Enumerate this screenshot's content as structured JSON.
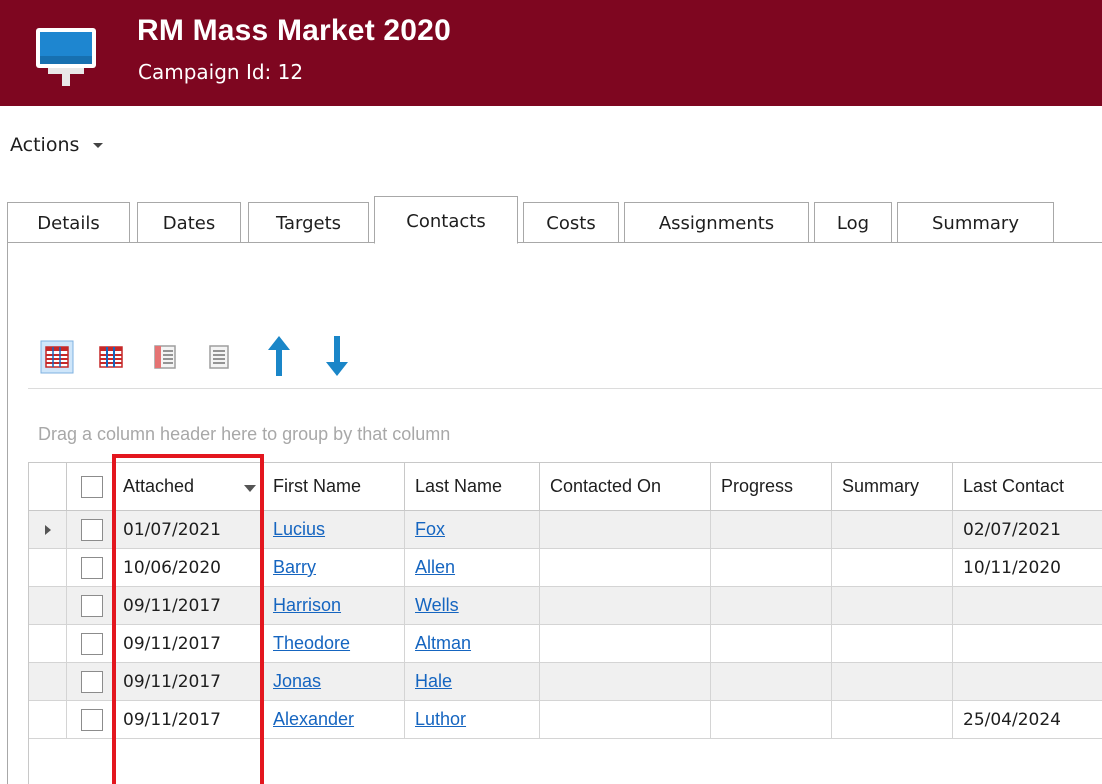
{
  "header": {
    "title": "RM Mass Market 2020",
    "subtitle": "Campaign Id: 12",
    "icon": "presentation-board-icon"
  },
  "actions": {
    "label": "Actions"
  },
  "tabs": [
    {
      "label": "Details"
    },
    {
      "label": "Dates"
    },
    {
      "label": "Targets"
    },
    {
      "label": "Contacts",
      "active": true
    },
    {
      "label": "Costs"
    },
    {
      "label": "Assignments"
    },
    {
      "label": "Log"
    },
    {
      "label": "Summary"
    }
  ],
  "toolbar": {
    "icons": [
      "grid-view-icon",
      "grid-columns-icon",
      "grid-detail-icon",
      "grid-list-icon",
      "move-up-icon",
      "move-down-icon"
    ]
  },
  "grid": {
    "group_hint": "Drag a column header here to group by that column",
    "columns": [
      "Attached",
      "First Name",
      "Last Name",
      "Contacted On",
      "Progress",
      "Summary",
      "Last Contact"
    ],
    "rows": [
      {
        "attached": "01/07/2021",
        "first": "Lucius",
        "last": "Fox",
        "contacted": "",
        "progress": "",
        "summary": "",
        "last_contact": "02/07/2021"
      },
      {
        "attached": "10/06/2020",
        "first": "Barry",
        "last": "Allen",
        "contacted": "",
        "progress": "",
        "summary": "",
        "last_contact": "10/11/2020"
      },
      {
        "attached": "09/11/2017",
        "first": "Harrison",
        "last": "Wells",
        "contacted": "",
        "progress": "",
        "summary": "",
        "last_contact": ""
      },
      {
        "attached": "09/11/2017",
        "first": "Theodore",
        "last": "Altman",
        "contacted": "",
        "progress": "",
        "summary": "",
        "last_contact": ""
      },
      {
        "attached": "09/11/2017",
        "first": "Jonas",
        "last": "Hale",
        "contacted": "",
        "progress": "",
        "summary": "",
        "last_contact": ""
      },
      {
        "attached": "09/11/2017",
        "first": "Alexander",
        "last": "Luthor",
        "contacted": "",
        "progress": "",
        "summary": "",
        "last_contact": "25/04/2024"
      }
    ]
  },
  "colors": {
    "banner": "#7e0620",
    "link": "#1565c0",
    "highlight": "#e3161e",
    "arrow": "#1a86c8"
  }
}
